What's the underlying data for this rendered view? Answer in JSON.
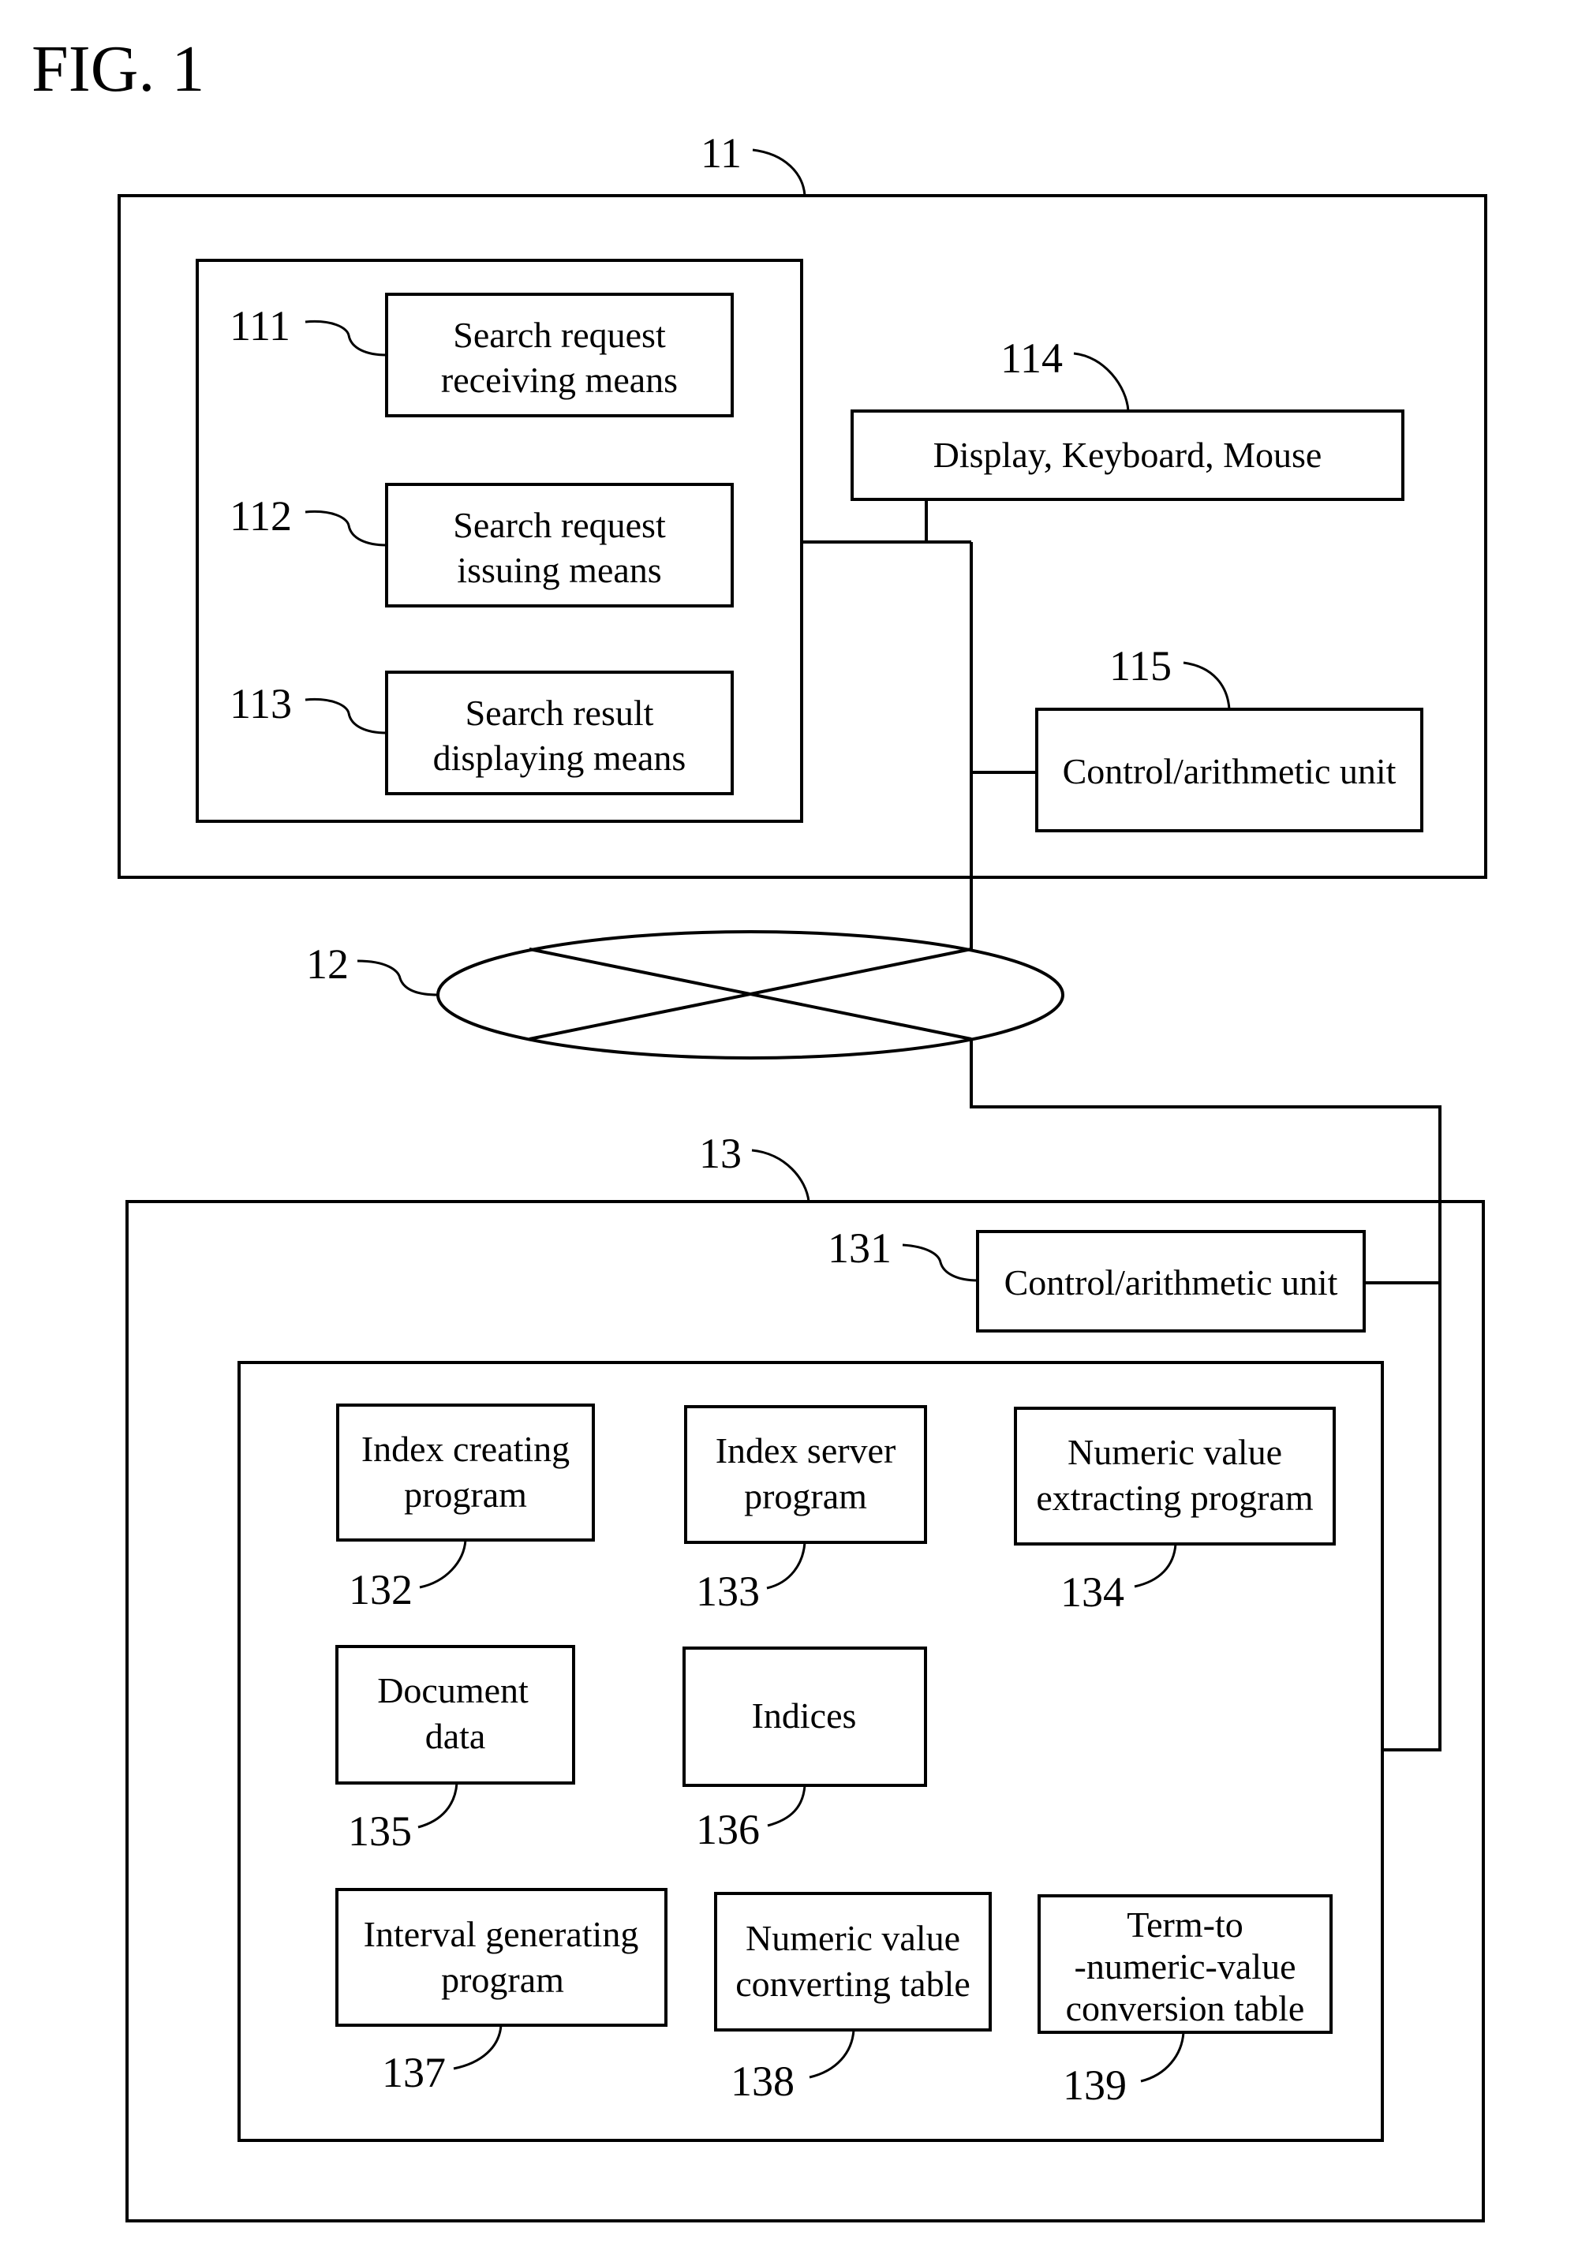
{
  "figure": {
    "title": "FIG. 1",
    "line_color": "#000000",
    "background_color": "#ffffff"
  },
  "client": {
    "ref": "11",
    "means": [
      {
        "ref": "111",
        "lines": [
          "Search request",
          "receiving means"
        ]
      },
      {
        "ref": "112",
        "lines": [
          "Search request",
          "issuing means"
        ]
      },
      {
        "ref": "113",
        "lines": [
          "Search result",
          "displaying means"
        ]
      }
    ],
    "io": {
      "ref": "114",
      "label": "Display, Keyboard, Mouse"
    },
    "cpu": {
      "ref": "115",
      "label": "Control/arithmetic unit"
    }
  },
  "network": {
    "ref": "12"
  },
  "server": {
    "ref": "13",
    "cpu": {
      "ref": "131",
      "label": "Control/arithmetic unit"
    },
    "components": [
      {
        "ref": "132",
        "lines": [
          "Index creating",
          "program"
        ]
      },
      {
        "ref": "133",
        "lines": [
          "Index server",
          "program"
        ]
      },
      {
        "ref": "134",
        "lines": [
          "Numeric value",
          "extracting program"
        ]
      },
      {
        "ref": "135",
        "lines": [
          "Document",
          "data"
        ]
      },
      {
        "ref": "136",
        "lines": [
          "Indices"
        ]
      },
      {
        "ref": "137",
        "lines": [
          "Interval generating",
          "program"
        ]
      },
      {
        "ref": "138",
        "lines": [
          "Numeric value",
          "converting table"
        ]
      },
      {
        "ref": "139",
        "lines": [
          "Term-to",
          "-numeric-value",
          "conversion table"
        ]
      }
    ]
  }
}
